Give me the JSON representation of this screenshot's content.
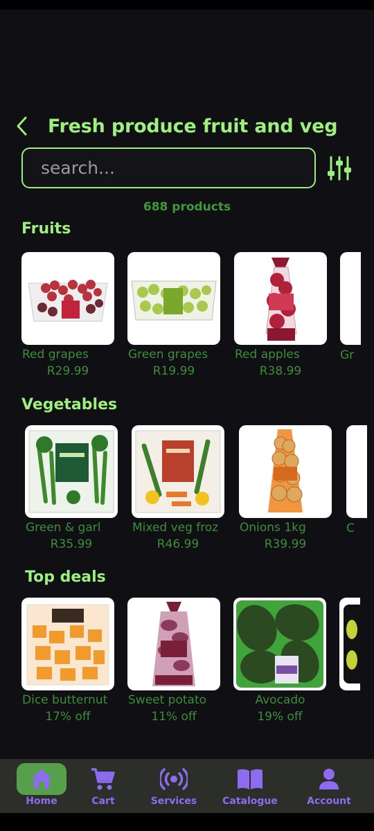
{
  "header": {
    "title": "Fresh produce fruit and veg"
  },
  "search": {
    "placeholder": "search..."
  },
  "product_count": "688 products",
  "sections": [
    {
      "title": "Fruits",
      "items": [
        {
          "name": "Red grapes",
          "sub": "R29.99"
        },
        {
          "name": "Green grapes",
          "sub": "R19.99"
        },
        {
          "name": "Red apples",
          "sub": "R38.99"
        }
      ],
      "peek_label": "Gr"
    },
    {
      "title": "Vegetables",
      "items": [
        {
          "name": "Green & garl",
          "sub": "R35.99"
        },
        {
          "name": "Mixed veg froz",
          "sub": "R46.99"
        },
        {
          "name": "Onions 1kg",
          "sub": "R39.99"
        }
      ],
      "peek_label": "C"
    },
    {
      "title": "Top deals",
      "items": [
        {
          "name": "Dice butternut",
          "sub": "17% off"
        },
        {
          "name": "Sweet potato",
          "sub": "11% off"
        },
        {
          "name": "Avocado",
          "sub": "19% off"
        }
      ],
      "peek_label": ""
    }
  ],
  "nav": [
    {
      "label": "Home",
      "icon": "home-icon",
      "active": true
    },
    {
      "label": "Cart",
      "icon": "cart-icon"
    },
    {
      "label": "Services",
      "icon": "services-icon"
    },
    {
      "label": "Catalogue",
      "icon": "catalogue-icon"
    },
    {
      "label": "Account",
      "icon": "account-icon"
    }
  ],
  "colors": {
    "accent": "#9ef07e",
    "price": "#3c8f3a",
    "nav_label": "#8e6cf1",
    "nav_active": "#56a04c"
  }
}
